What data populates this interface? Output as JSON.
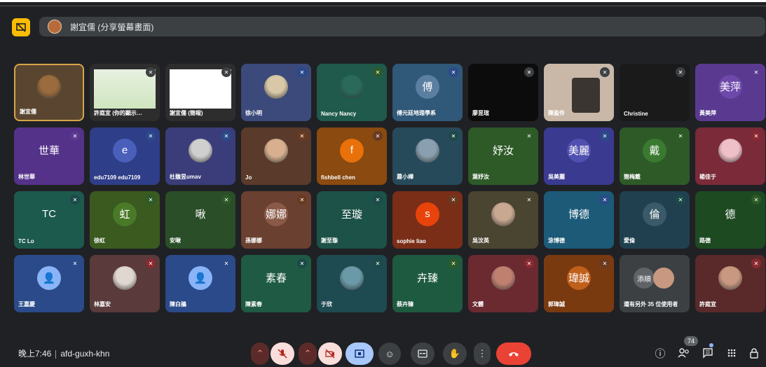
{
  "presenter_bar": {
    "label": "謝宜儒 (分享螢幕畫面)"
  },
  "tiles": [
    {
      "name": "謝宜儒",
      "kind": "photo",
      "bg": "#5a4630",
      "color": "#9a6b3c",
      "self": true
    },
    {
      "name": "許庭宜 (你的顯示…",
      "kind": "slide",
      "bg": "#2d2d2d",
      "mute": "dark"
    },
    {
      "name": "謝宜儒 (簡報)",
      "kind": "slide2",
      "bg": "#2d2d2d",
      "mute": "dark"
    },
    {
      "name": "徐小明",
      "kind": "photo",
      "bg": "#3b4a7a",
      "color": "#d8c8a8",
      "mute": "blue"
    },
    {
      "name": "Nancy Nancy",
      "kind": "photo",
      "bg": "#1f5a4c",
      "color": "#2a6a5a",
      "mute": "green"
    },
    {
      "name": "傅元廷地理學系",
      "kind": "letter",
      "letter": "傅",
      "bg": "#305878",
      "color": "#5b7fa0",
      "mute": "blue"
    },
    {
      "name": "廖昱瑄",
      "kind": "black",
      "bg": "#0c0c0c",
      "mute": "dark"
    },
    {
      "name": "陳盈伶",
      "kind": "video",
      "bg": "#c9b8a8",
      "mute": "dark"
    },
    {
      "name": "Christine",
      "kind": "black",
      "bg": "#1a1a1a",
      "mute": "dark"
    },
    {
      "name": "黃美萍",
      "kind": "letter",
      "letter": "美萍",
      "bg": "#5a3a90",
      "color": "#6e49ab",
      "mute": "purple"
    },
    {
      "name": "林世華",
      "kind": "letter",
      "letter": "世華",
      "bg": "#54328a",
      "color": "#54328a",
      "mute": "purple"
    },
    {
      "name": "edu7109 edu7109",
      "kind": "letter",
      "letter": "e",
      "bg": "#2f3e88",
      "color": "#4a5fba",
      "mute": "blue"
    },
    {
      "name": "杜馥昱umav",
      "kind": "photo",
      "bg": "#3b3d7a",
      "color": "#cfcfcf",
      "mute": "blue"
    },
    {
      "name": "Jo",
      "kind": "photo",
      "bg": "#5a3a2a",
      "color": "#d8b090",
      "mute": "brown"
    },
    {
      "name": "fishbell chen",
      "kind": "letter",
      "letter": "f",
      "bg": "#8a4a10",
      "color": "#e8710a",
      "mute": "brown"
    },
    {
      "name": "蕭小樺",
      "kind": "photo",
      "bg": "#274a5a",
      "color": "#8aa0b0",
      "mute": "teal"
    },
    {
      "name": "葉妤汝",
      "kind": "letter",
      "letter": "妤汝",
      "bg": "#2e5a28",
      "color": "#2e5a28",
      "mute": "green"
    },
    {
      "name": "吳美麗",
      "kind": "letter",
      "letter": "美麗",
      "bg": "#3a3a90",
      "color": "#5050b0",
      "mute": "blue"
    },
    {
      "name": "簡梅戴",
      "kind": "letter",
      "letter": "戴",
      "bg": "#2e5a28",
      "color": "#3a7a30",
      "mute": "green"
    },
    {
      "name": "楊佳于",
      "kind": "photo",
      "bg": "#7a2a38",
      "color": "#f0c0c8",
      "mute": "red"
    },
    {
      "name": "TC Lo",
      "kind": "letter",
      "letter": "TC",
      "bg": "#1c5a4e",
      "color": "#1c5a4e",
      "mute": "teal"
    },
    {
      "name": "徐虹",
      "kind": "letter",
      "letter": "虹",
      "bg": "#3a5a20",
      "color": "#4a7a28",
      "mute": "green"
    },
    {
      "name": "安啾",
      "kind": "letter",
      "letter": "啾",
      "bg": "#2a4e28",
      "color": "#2a4e28",
      "mute": "green"
    },
    {
      "name": "孫娜娜",
      "kind": "letter",
      "letter": "娜娜",
      "bg": "#6a4030",
      "color": "#8a5a48",
      "mute": "brown"
    },
    {
      "name": "謝至璇",
      "kind": "letter",
      "letter": "至璇",
      "bg": "#1c5248",
      "color": "#1c5248",
      "mute": "teal"
    },
    {
      "name": "sophie liao",
      "kind": "letter",
      "letter": "s",
      "bg": "#7a2e18",
      "color": "#e8430a",
      "mute": "brown"
    },
    {
      "name": "吳汶英",
      "kind": "photo",
      "bg": "#4a4530",
      "color": "#c8a890",
      "mute": "olive"
    },
    {
      "name": "涂博德",
      "kind": "letter",
      "letter": "博德",
      "bg": "#1c5a78",
      "color": "#1c5a78",
      "mute": "blue"
    },
    {
      "name": "愛倫",
      "kind": "letter",
      "letter": "倫",
      "bg": "#204050",
      "color": "#3a5a6a",
      "mute": "teal"
    },
    {
      "name": "路德",
      "kind": "letter",
      "letter": "德",
      "bg": "#1e4a22",
      "color": "#1e4a22",
      "mute": "green"
    },
    {
      "name": "王嘉慶",
      "kind": "letter",
      "letter": "👤",
      "bg": "#2a4a8a",
      "color": "#8ab4f8",
      "mute": "blue"
    },
    {
      "name": "林嘉安",
      "kind": "photo",
      "bg": "#5a3a3a",
      "color": "#e0d8d0",
      "mute": "red"
    },
    {
      "name": "陳白鵑",
      "kind": "letter",
      "letter": "👤",
      "bg": "#2a4a8a",
      "color": "#8ab4f8",
      "mute": "blue"
    },
    {
      "name": "陳素春",
      "kind": "letter",
      "letter": "素春",
      "bg": "#1e5a44",
      "color": "#1e5a44",
      "mute": "teal"
    },
    {
      "name": "于欣",
      "kind": "photo",
      "bg": "#1e4a52",
      "color": "#6a9aa8",
      "mute": "teal"
    },
    {
      "name": "蔡卉臻",
      "kind": "letter",
      "letter": "卉臻",
      "bg": "#1e5a40",
      "color": "#1e5a40",
      "mute": "green"
    },
    {
      "name": "文體",
      "kind": "photo",
      "bg": "#6a2a30",
      "color": "#c08070",
      "mute": "red"
    },
    {
      "name": "郭瑋誠",
      "kind": "letter",
      "letter": "瑋誠",
      "bg": "#7a3a10",
      "color": "#c0601a",
      "mute": "brown"
    },
    {
      "name": "還有另外 35 位使用者",
      "kind": "more",
      "bg": "#3c4043",
      "mute": "none",
      "more_label": "添順"
    },
    {
      "name": "許庭宜",
      "kind": "photo",
      "bg": "#5a2a2a",
      "color": "#c89880",
      "mute": "red"
    }
  ],
  "bottom": {
    "time": "晚上7:46",
    "meeting_code": "afd-guxh-khn",
    "participants_count": "74"
  },
  "icons": {
    "chevron": "^",
    "mic_off": "🎙",
    "cam_off": "⊘",
    "present": "▣",
    "emoji": "☺",
    "captions": "CC",
    "hand": "✋",
    "more": "⋮",
    "end": "☎",
    "info": "ⓘ",
    "people": "👥",
    "chat": "💬",
    "activities": "⋯",
    "lock": "🔒"
  }
}
